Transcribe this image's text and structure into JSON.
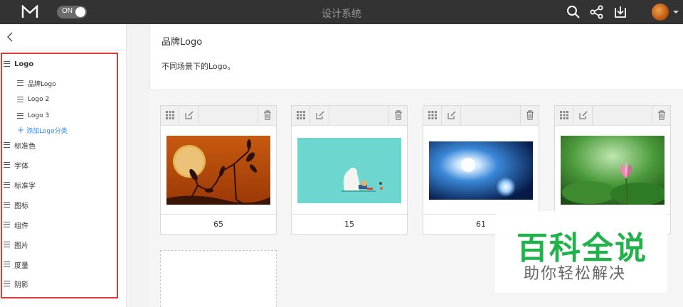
{
  "app": {
    "title": "设计系统",
    "toggle_label": "ON"
  },
  "topbar_icons": [
    "search-icon",
    "share-icon",
    "download-icon"
  ],
  "sidebar": {
    "items": [
      {
        "label": "Logo",
        "level": 0
      },
      {
        "label": "品牌Logo",
        "level": 1
      },
      {
        "label": "Logo 2",
        "level": 1
      },
      {
        "label": "Logo 3",
        "level": 1
      },
      {
        "label": "标准色",
        "level": 0
      },
      {
        "label": "字体",
        "level": 0
      },
      {
        "label": "标准字",
        "level": 0
      },
      {
        "label": "图标",
        "level": 0
      },
      {
        "label": "组件",
        "level": 0
      },
      {
        "label": "图片",
        "level": 0
      },
      {
        "label": "度量",
        "level": 0
      },
      {
        "label": "阴影",
        "level": 0
      }
    ],
    "add_label": "添加Logo分类"
  },
  "main": {
    "title": "品牌Logo",
    "description": "不同场景下的Logo。"
  },
  "cards": [
    {
      "value": "65",
      "image": "sunset-silhouette"
    },
    {
      "value": "15",
      "image": "teal-illustration"
    },
    {
      "value": "61",
      "image": "blue-burst"
    },
    {
      "value": "",
      "image": "lotus-flower"
    }
  ],
  "watermark": {
    "title": "百科全说",
    "subtitle": "助你轻松解决"
  },
  "colors": {
    "topbar": "#333333",
    "accent": "#2d8cf0",
    "highlight_border": "#e53935",
    "watermark_green": "#22b24c"
  }
}
